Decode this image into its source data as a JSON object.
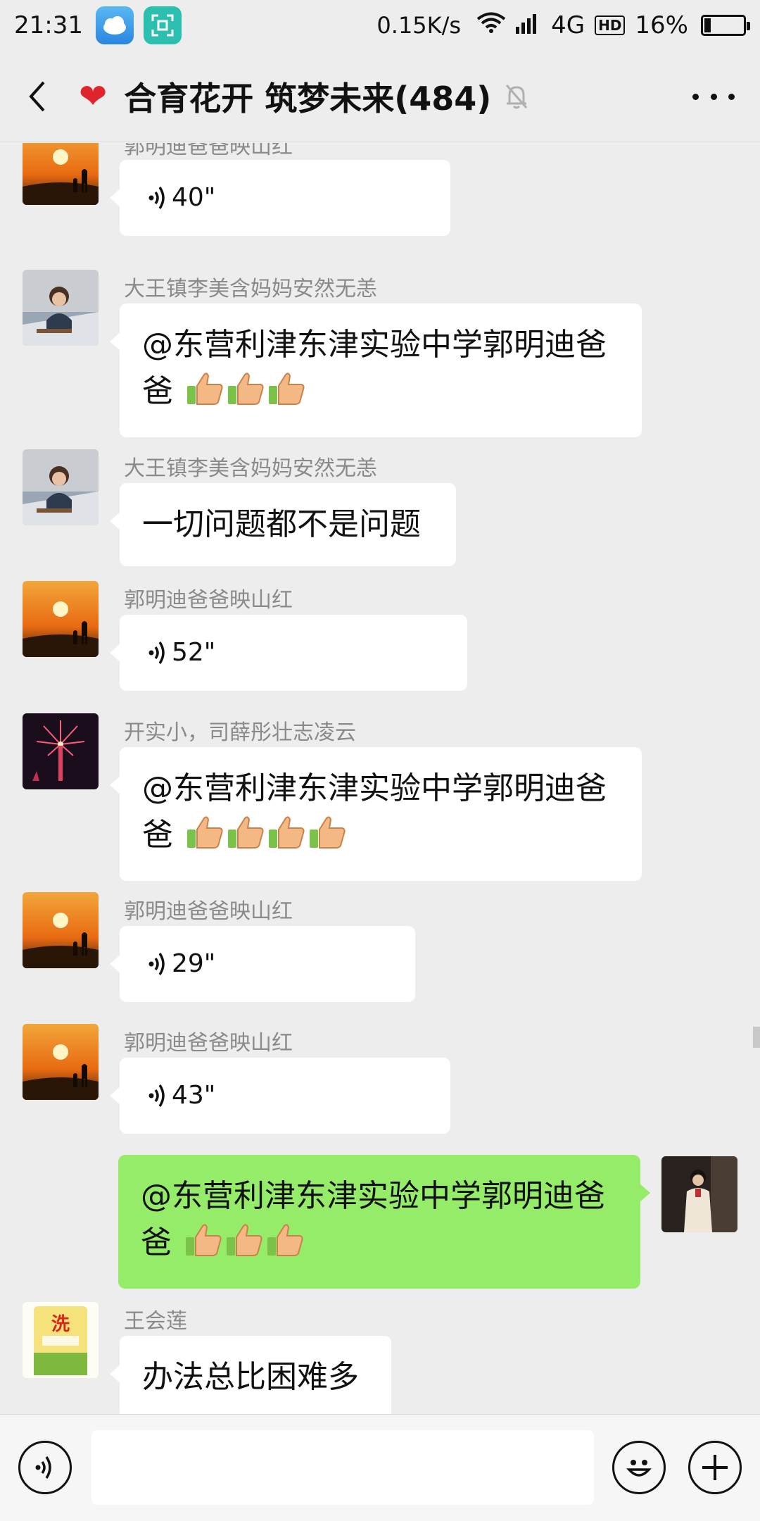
{
  "status_bar": {
    "time": "21:31",
    "net_speed": "0.15K/s",
    "network": "4G",
    "hd": "HD",
    "battery": "16%",
    "battery_level": 0.16
  },
  "header": {
    "title": "合育花开 筑梦未来(484)",
    "heart_icon": "heart-emoji",
    "mute_icon": "bell-off-icon",
    "more_icon": "more-icon"
  },
  "messages": [
    {
      "sender": "郭明迪爸爸映山红",
      "voice": "40\""
    },
    {
      "sender": "大王镇李美含妈妈安然无恙",
      "line1": "@东营利津东津实验中学郭明迪爸",
      "line2": "爸"
    },
    {
      "sender": "大王镇李美含妈妈安然无恙",
      "text": "一切问题都不是问题"
    },
    {
      "sender": "郭明迪爸爸映山红",
      "voice": "52\""
    },
    {
      "sender": "开实小，司薛彤壮志凌云",
      "line1": "@东营利津东津实验中学郭明迪爸",
      "line2": "爸"
    },
    {
      "sender": "郭明迪爸爸映山红",
      "voice": "29\""
    },
    {
      "sender": "郭明迪爸爸映山红",
      "voice": "43\""
    },
    {
      "sender": "",
      "line1": "@东营利津东津实验中学郭明迪爸",
      "line2": "爸",
      "mine": true
    },
    {
      "sender": "王会莲",
      "text": "办法总比困难多"
    }
  ],
  "input": {
    "placeholder": "",
    "voice_icon": "voice-icon",
    "emoji_icon": "emoji-icon",
    "plus_icon": "plus-icon"
  },
  "colors": {
    "background": "#ededed",
    "bubble_incoming": "#ffffff",
    "bubble_outgoing": "#95ec69",
    "sender_name": "#8a8a8a"
  }
}
